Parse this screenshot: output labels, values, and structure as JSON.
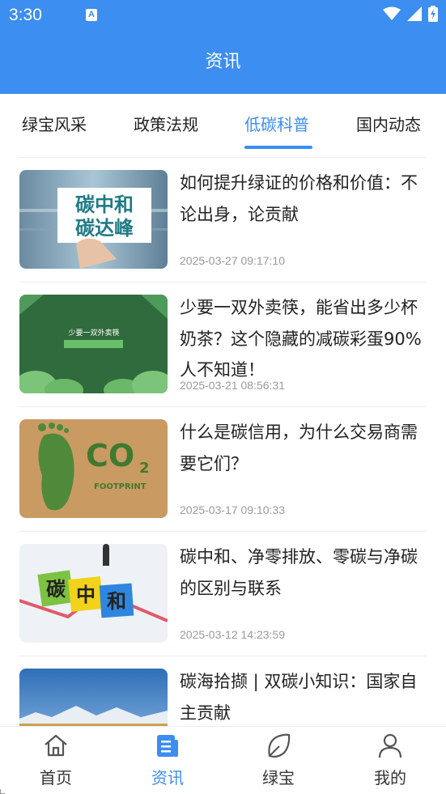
{
  "status_bar": {
    "time": "3:30",
    "notification_icon": "A"
  },
  "header": {
    "title": "资讯"
  },
  "tabs": [
    {
      "label": "绿宝风采",
      "active": false
    },
    {
      "label": "政策法规",
      "active": false
    },
    {
      "label": "低碳科普",
      "active": true
    },
    {
      "label": "国内动态",
      "active": false
    }
  ],
  "articles": [
    {
      "title": "如何提升绿证的价格和价值：不论出身，论贡献",
      "date": "2025-03-27 09:17:10",
      "thumb": {
        "line1": "碳中和",
        "line2": "碳达峰"
      }
    },
    {
      "title": "少要一双外卖筷，能省出多少杯奶茶？这个隐藏的减碳彩蛋90%人不知道！",
      "date": "2025-03-21 08:56:31",
      "thumb": {
        "line1": "少要一双外卖筷"
      }
    },
    {
      "title": "什么是碳信用，为什么交易商需要它们？",
      "date": "2025-03-17 09:10:33",
      "thumb": {
        "co": "CO",
        "sub": "2",
        "caption": "FOOTPRINT"
      }
    },
    {
      "title": "碳中和、净零排放、零碳与净碳的区别与联系",
      "date": "2025-03-12 14:23:59",
      "thumb": {
        "b1": "碳",
        "b2": "中",
        "b3": "和"
      }
    },
    {
      "title": "碳海拾撷 | 双碳小知识：国家自主贡献",
      "date": ""
    }
  ],
  "bottom_nav": [
    {
      "label": "首页",
      "icon": "home-icon",
      "active": false
    },
    {
      "label": "资讯",
      "icon": "news-icon",
      "active": true
    },
    {
      "label": "绿宝",
      "icon": "leaf-icon",
      "active": false
    },
    {
      "label": "我的",
      "icon": "user-icon",
      "active": false
    }
  ],
  "colors": {
    "primary": "#3c8ef0",
    "text": "#222222",
    "muted": "#9a9a9a"
  }
}
